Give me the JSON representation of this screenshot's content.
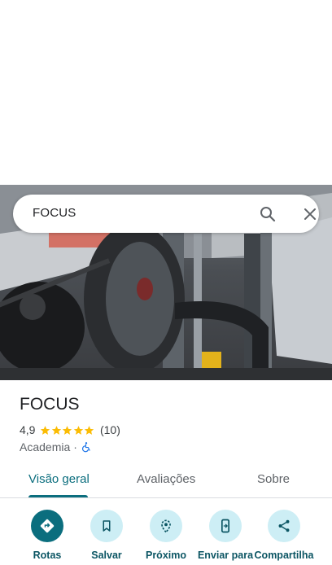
{
  "search": {
    "query": "FOCUS"
  },
  "place": {
    "name": "FOCUS",
    "rating": "4,9",
    "stars": 5,
    "review_count": "(10)",
    "category": "Academia",
    "separator": "·"
  },
  "tabs": [
    {
      "label": "Visão geral",
      "active": true
    },
    {
      "label": "Avaliações",
      "active": false
    },
    {
      "label": "Sobre",
      "active": false
    }
  ],
  "actions": [
    {
      "label": "Rotas",
      "icon": "directions-icon"
    },
    {
      "label": "Salvar",
      "icon": "bookmark-icon"
    },
    {
      "label": "Próximo",
      "icon": "nearby-icon"
    },
    {
      "label": "Enviar para",
      "icon": "send-to-phone-icon"
    },
    {
      "label": "Compartilha",
      "icon": "share-icon"
    }
  ],
  "colors": {
    "accent": "#0b6e7e",
    "action_bg": "#cdeef5",
    "star": "#fbbc04"
  }
}
